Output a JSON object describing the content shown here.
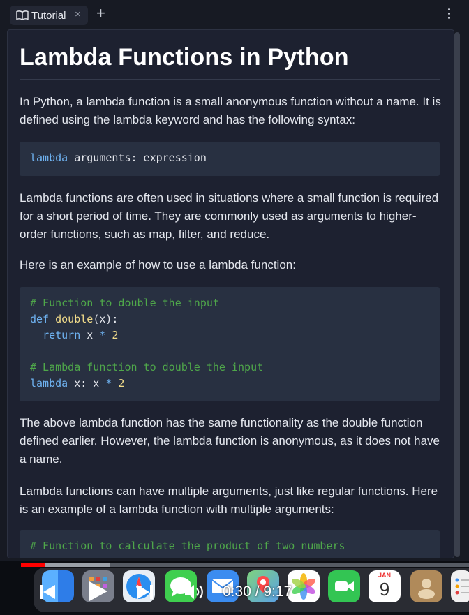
{
  "tab": {
    "label": "Tutorial",
    "close": "×",
    "add": "+"
  },
  "article": {
    "title": "Lambda Functions in Python",
    "p1": "In Python, a lambda function is a small anonymous function without a name. It is defined using the lambda keyword and has the following syntax:",
    "code1": {
      "kw": "lambda",
      "rest": " arguments: expression"
    },
    "p2": "Lambda functions are often used in situations where a small function is required for a short period of time. They are commonly used as arguments to higher-order functions, such as map, filter, and reduce.",
    "p3": "Here is an example of how to use a lambda function:",
    "code2": {
      "c1": "# Function to double the input",
      "def": "def",
      "fname": "double",
      "params": "(x):",
      "ret": "return",
      "retexpr1": " x ",
      "retop": "*",
      "retnum": " 2",
      "c2": "# Lambda function to double the input",
      "lkw": "lambda",
      "lexpr1": " x: x ",
      "lop": "*",
      "lnum": " 2"
    },
    "p4": "The above lambda function has the same functionality as the double function defined earlier. However, the lambda function is anonymous, as it does not have a name.",
    "p5": "Lambda functions can have multiple arguments, just like regular functions. Here is an example of a lambda function with multiple arguments:",
    "code3": {
      "c1": "# Function to calculate the product of two numbers"
    }
  },
  "video": {
    "time": "0:30 / 9:17",
    "progress_fraction": 0.054,
    "buffered_fraction": 0.2
  },
  "dock": {
    "calendar_month": "JAN",
    "calendar_day": "9",
    "colors": {
      "finder": "#3a8ef5",
      "messages": "#3fcf4f",
      "mail": "#3b8cf0",
      "facetime": "#33c553"
    }
  }
}
